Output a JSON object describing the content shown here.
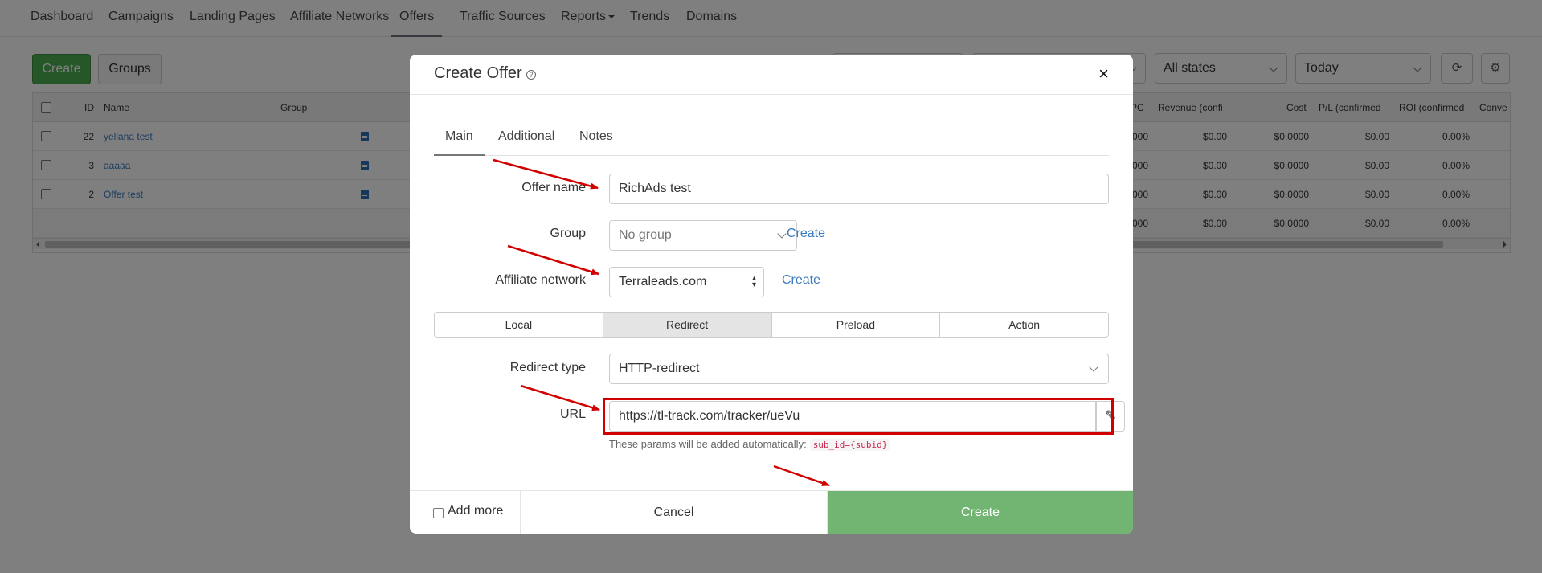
{
  "topnav": {
    "items": [
      "Dashboard",
      "Campaigns",
      "Landing Pages",
      "Affiliate Networks",
      "Offers",
      "Traffic Sources",
      "Reports",
      "Trends",
      "Domains"
    ],
    "active": "Offers"
  },
  "toolbar": {
    "create_label": "Create",
    "groups_label": "Groups",
    "state_filter": "All states",
    "date_filter": "Today",
    "refresh_icon": "refresh-icon",
    "settings_icon": "settings-icon"
  },
  "table": {
    "columns": [
      "ID",
      "Name",
      "Group",
      "PC",
      "Revenue (confi",
      "Cost",
      "P/L (confirmed",
      "ROI (confirmed",
      "Conve"
    ],
    "rows": [
      {
        "id": "22",
        "name": "yellana test",
        "cpc": "000",
        "revenue": "$0.00",
        "cost": "$0.0000",
        "pl": "$0.00",
        "roi": "0.00%"
      },
      {
        "id": "3",
        "name": "aaaaa",
        "cpc": "000",
        "revenue": "$0.00",
        "cost": "$0.0000",
        "pl": "$0.00",
        "roi": "0.00%"
      },
      {
        "id": "2",
        "name": "Offer test",
        "cpc": "000",
        "revenue": "$0.00",
        "cost": "$0.0000",
        "pl": "$0.00",
        "roi": "0.00%"
      }
    ],
    "totals": {
      "cpc": "000",
      "revenue": "$0.00",
      "cost": "$0.0000",
      "pl": "$0.00",
      "roi": "0.00%"
    }
  },
  "modal": {
    "title": "Create Offer",
    "close_glyph": "×",
    "help_glyph": "?",
    "tabs": [
      "Main",
      "Additional",
      "Notes"
    ],
    "active_tab": "Main",
    "offer_name": {
      "label": "Offer name",
      "value": "RichAds test"
    },
    "group": {
      "label": "Group",
      "value": "No group",
      "create_link": "Create"
    },
    "affiliate_network": {
      "label": "Affiliate network",
      "value": "Terraleads.com",
      "create_link": "Create"
    },
    "modes": [
      "Local",
      "Redirect",
      "Preload",
      "Action"
    ],
    "active_mode": "Redirect",
    "redirect_type": {
      "label": "Redirect type",
      "value": "HTTP-redirect"
    },
    "url": {
      "label": "URL",
      "value": "https://tl-track.com/tracker/ueVu",
      "edit_icon": "edit-icon"
    },
    "hint_text": "These params will be added automatically:",
    "hint_code": "sub_id={subid}",
    "footer": {
      "add_more": "Add more",
      "cancel": "Cancel",
      "create": "Create"
    }
  },
  "colors": {
    "primary_green": "#4caf50",
    "create_green": "#72b572",
    "link_blue": "#3a7bbf",
    "annotation_red": "#d10000"
  }
}
